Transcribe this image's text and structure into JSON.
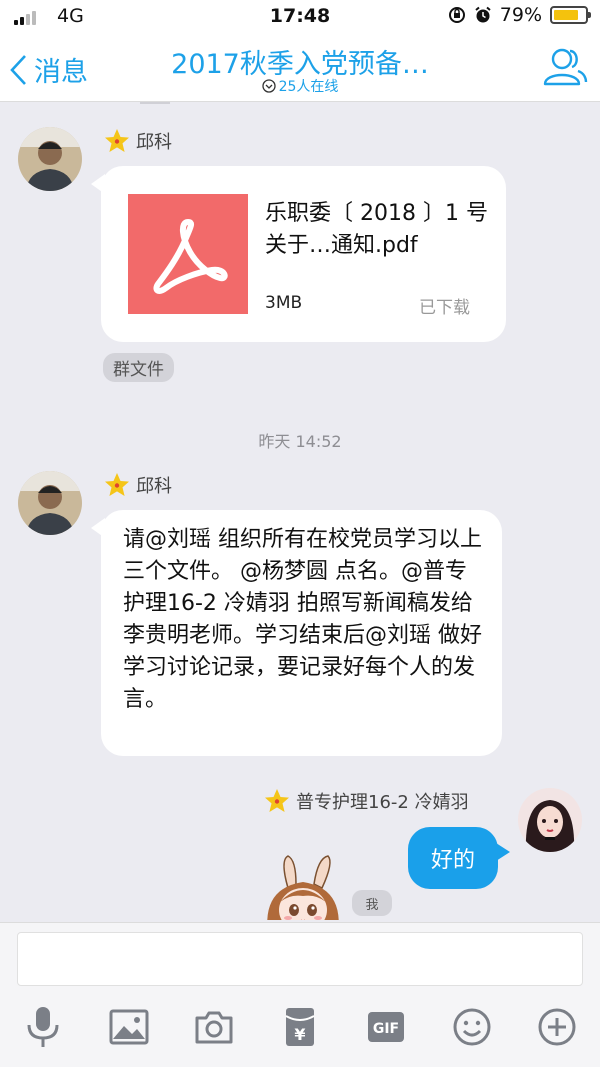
{
  "status": {
    "carrier": "4G",
    "time": "17:48",
    "battery": "79%",
    "battery_level": 0.79
  },
  "header": {
    "back_label": "消息",
    "title": "2017秋季入党预备…",
    "online": "25人在线"
  },
  "messages": {
    "file": {
      "sender": "邱科",
      "name": "乐职委〔 2018 〕1 号 关于…通知.pdf",
      "size": "3MB",
      "status": "已下载",
      "tag": "群文件"
    },
    "time_separator": "昨天 14:52",
    "text": {
      "sender": "邱科",
      "body": "请@刘瑶 组织所有在校党员学习以上三个文件。 @杨梦圆 点名。@普专护理16-2 冷婧羽 拍照写新闻稿发给李贵明老师。学习结束后@刘瑶 做好学习讨论记录，要记录好每个人的发言。"
    },
    "mine": {
      "sender": "普专护理16-2 冷婧羽",
      "body": "好的",
      "me_tag": "我"
    }
  },
  "colors": {
    "accent": "#1da1e8",
    "pdf": "#f26a6a",
    "my_bubble": "#1aa0ea",
    "star": "#f5c518"
  },
  "toolbar": [
    "microphone-icon",
    "image-icon",
    "camera-icon",
    "red-packet-icon",
    "gif-icon",
    "emoji-icon",
    "plus-icon"
  ],
  "toolbar_gif_label": "GIF",
  "toolbar_money_glyph": "¥"
}
